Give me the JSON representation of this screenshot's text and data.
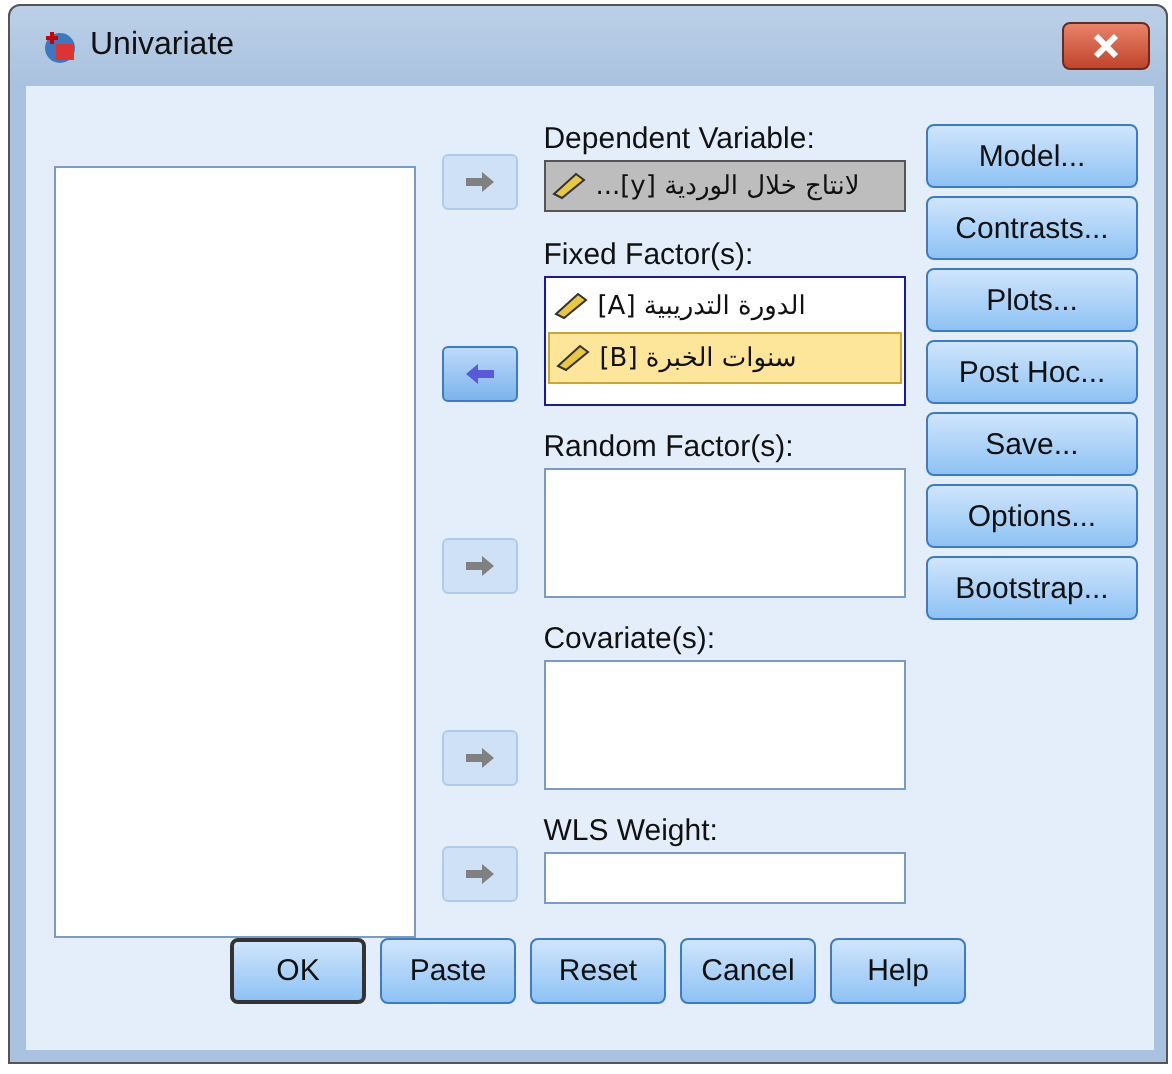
{
  "window": {
    "title": "Univariate"
  },
  "sections": [
    {
      "label": "Dependent Variable:",
      "kind": "single",
      "arrow": {
        "kind": "add",
        "enabled": false
      },
      "items": [
        {
          "name": "لانتاج خلال الوردية [y]...",
          "selected": false
        }
      ]
    },
    {
      "label": "Fixed Factor(s):",
      "kind": "list",
      "arrow": {
        "kind": "remove",
        "enabled": true
      },
      "items": [
        {
          "name": "الدورة التدريبية [A]",
          "selected": false
        },
        {
          "name": "سنوات الخبرة [B]",
          "selected": true
        }
      ]
    },
    {
      "label": "Random Factor(s):",
      "kind": "list",
      "arrow": {
        "kind": "add",
        "enabled": false
      }
    },
    {
      "label": "Covariate(s):",
      "kind": "list",
      "arrow": {
        "kind": "add",
        "enabled": false
      }
    },
    {
      "label": "WLS Weight:",
      "kind": "single",
      "arrow": {
        "kind": "add",
        "enabled": false
      }
    }
  ],
  "side_buttons": [
    "Model...",
    "Contrasts...",
    "Plots...",
    "Post Hoc...",
    "Save...",
    "Options...",
    "Bootstrap..."
  ],
  "bottom_buttons": [
    {
      "label": "OK",
      "default": true
    },
    {
      "label": "Paste",
      "default": false
    },
    {
      "label": "Reset",
      "default": false
    },
    {
      "label": "Cancel",
      "default": false
    },
    {
      "label": "Help",
      "default": false
    }
  ]
}
